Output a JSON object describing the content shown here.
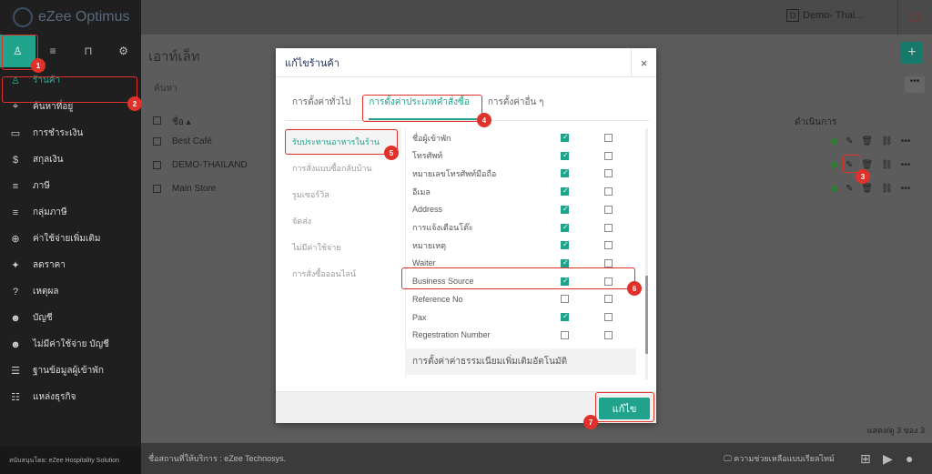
{
  "app": {
    "logo_text": "eZee Optimus",
    "org": "Demo- Thai...",
    "org_initial": "D"
  },
  "sidebar": {
    "items": [
      {
        "icon": "store-icon",
        "glyph": "♙",
        "label": "ร้านค้า"
      },
      {
        "icon": "map-pin-icon",
        "glyph": "⌖",
        "label": "ค้นหาที่อยู่"
      },
      {
        "icon": "card-icon",
        "glyph": "▭",
        "label": "การชำระเงิน"
      },
      {
        "icon": "dollar-icon",
        "glyph": "$",
        "label": "สกุลเงิน"
      },
      {
        "icon": "list-icon",
        "glyph": "≡",
        "label": "ภาษี"
      },
      {
        "icon": "list-icon",
        "glyph": "≡",
        "label": "กลุ่มภาษี"
      },
      {
        "icon": "plus-circle-icon",
        "glyph": "⊕",
        "label": "ค่าใช้จ่ายเพิ่มเติม"
      },
      {
        "icon": "gift-icon",
        "glyph": "✦",
        "label": "ลดราคา"
      },
      {
        "icon": "question-icon",
        "glyph": "?",
        "label": "เหตุผล"
      },
      {
        "icon": "user-icon",
        "glyph": "☻",
        "label": "บัญชี"
      },
      {
        "icon": "user-icon",
        "glyph": "☻",
        "label": "ไม่มีค่าใช้จ่าย บัญชี"
      },
      {
        "icon": "database-icon",
        "glyph": "☰",
        "label": "ฐานข้อมูลผู้เข้าพัก"
      },
      {
        "icon": "group-icon",
        "glyph": "☷",
        "label": "แหล่งธุรกิจ"
      }
    ],
    "footer": "สนับสนุนโดย: eZee Hospitality Solution"
  },
  "main": {
    "title": "เอาท์เล็ท",
    "search_label": "ค้นหา",
    "col_name": "ชื่อ ▴",
    "col_actions": "ดำเนินการ",
    "rows": [
      {
        "name": "Best Café"
      },
      {
        "name": "DEMO-THAILAND"
      },
      {
        "name": "Main Store"
      }
    ],
    "paging": "แสดง/ดู 3 ของ 3",
    "service_provider": "ชื่อสถานที่ให้บริการ : eZee Technosys.",
    "help": "ความช่วยเหลือแบบเรียลไทม์"
  },
  "modal": {
    "title": "แก้ไขร้านค้า",
    "close": "×",
    "tabs": [
      "การตั้งค่าทั่วไป",
      "การตั้งค่าประเภทคำสั่งซื้อ",
      "การตั้งค่าอื่น ๆ"
    ],
    "order_types": [
      "รับประทานอาหารในร้าน",
      "การสั่งแบบซื้อกลับบ้าน",
      "รูมเซอร์วิส",
      "จัดส่ง",
      "ไม่มีค่าใช้จ่าย",
      "การสั่งซื้อออนไลน์"
    ],
    "fields": [
      {
        "label": "ชื่อผู้เข้าพัก",
        "c1": true,
        "c2": false
      },
      {
        "label": "โทรศัพท์",
        "c1": true,
        "c2": false
      },
      {
        "label": "หมายเลขโทรศัพท์มือถือ",
        "c1": true,
        "c2": false
      },
      {
        "label": "อีเมล",
        "c1": true,
        "c2": false
      },
      {
        "label": "Address",
        "c1": true,
        "c2": false
      },
      {
        "label": "การแจ้งเตือนโต๊ะ",
        "c1": true,
        "c2": false
      },
      {
        "label": "หมายเหตุ",
        "c1": true,
        "c2": false
      },
      {
        "label": "Waiter",
        "c1": true,
        "c2": false
      },
      {
        "label": "Business Source",
        "c1": true,
        "c2": false
      },
      {
        "label": "Reference No",
        "c1": false,
        "c2": false
      },
      {
        "label": "Pax",
        "c1": true,
        "c2": false
      },
      {
        "label": "Regestration Number",
        "c1": false,
        "c2": false
      }
    ],
    "auto_fee": "การตั้งค่าค่าธรรมเนียมเพิ่มเติมอัตโนมัติ",
    "save": "แก้ไข"
  },
  "badges": [
    "1",
    "2",
    "3",
    "4",
    "5",
    "6",
    "7"
  ],
  "colors": {
    "accent": "#1fa38d",
    "highlight": "#e0322b"
  }
}
